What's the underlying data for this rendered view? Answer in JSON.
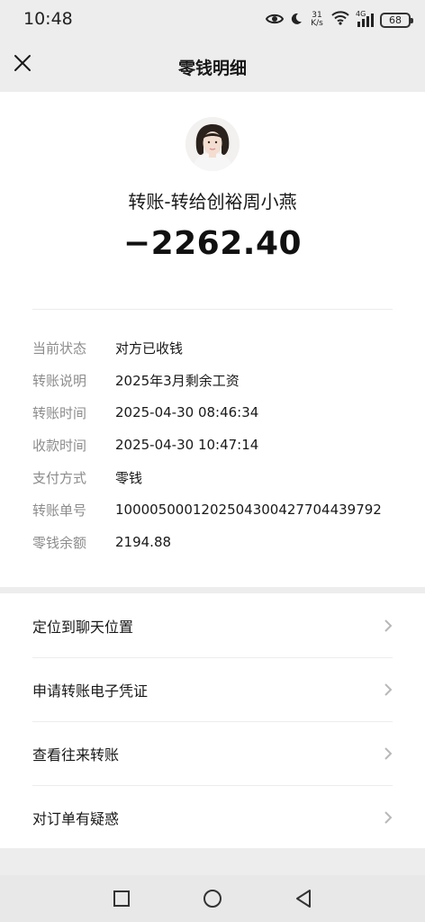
{
  "status_bar": {
    "time": "10:48",
    "net_speed_value": "31",
    "net_speed_unit": "K/s",
    "signal_label": "4G",
    "battery": "68",
    "icons": [
      "eye-icon",
      "moon-icon",
      "wifi-icon",
      "cell-signal-icon",
      "battery-icon"
    ]
  },
  "nav": {
    "title": "零钱明细",
    "close_icon": "close-icon"
  },
  "transaction": {
    "title": "转账-转给创裕周小燕",
    "amount": "−2262.40"
  },
  "details": [
    {
      "label": "当前状态",
      "value": "对方已收钱"
    },
    {
      "label": "转账说明",
      "value": "2025年3月剩余工资"
    },
    {
      "label": "转账时间",
      "value": "2025-04-30 08:46:34"
    },
    {
      "label": "收款时间",
      "value": "2025-04-30 10:47:14"
    },
    {
      "label": "支付方式",
      "value": "零钱"
    },
    {
      "label": "转账单号",
      "value": "1000050001202504300427704439792"
    },
    {
      "label": "零钱余额",
      "value": "2194.88"
    }
  ],
  "actions": [
    {
      "label": "定位到聊天位置"
    },
    {
      "label": "申请转账电子凭证"
    },
    {
      "label": "查看往来转账"
    },
    {
      "label": "对订单有疑惑"
    }
  ],
  "system_nav": [
    "recents-square-icon",
    "home-circle-icon",
    "back-triangle-icon"
  ],
  "colors": {
    "background": "#ededed",
    "card": "#ffffff",
    "label_gray": "#8c8c8c",
    "text": "#191919"
  }
}
